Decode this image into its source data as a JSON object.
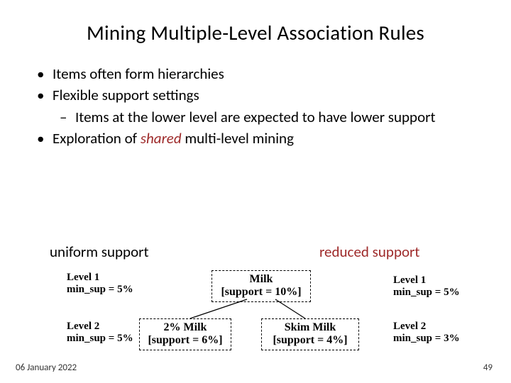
{
  "title": "Mining Multiple-Level Association Rules",
  "bullets": {
    "b1": "Items often form hierarchies",
    "b2": "Flexible support settings",
    "b2_sub": "Items at the lower level are expected to have lower support",
    "b3_pre": "Exploration of ",
    "b3_shared": "shared",
    "b3_post": " multi-level mining"
  },
  "labels": {
    "uniform": "uniform support",
    "reduced": "reduced support"
  },
  "levels": {
    "left1_a": "Level 1",
    "left1_b": "min_sup = 5%",
    "left2_a": "Level 2",
    "left2_b": "min_sup = 5%",
    "right1_a": "Level 1",
    "right1_b": "min_sup = 5%",
    "right2_a": "Level 2",
    "right2_b": "min_sup = 3%"
  },
  "boxes": {
    "milk_a": "Milk",
    "milk_b": "[support = 10%]",
    "two_a": "2% Milk",
    "two_b": "[support = 6%]",
    "skim_a": "Skim Milk",
    "skim_b": "[support = 4%]"
  },
  "footer": {
    "date": "06 January 2022",
    "page": "49"
  },
  "chart_data": {
    "type": "table",
    "title": "Multi-level support hierarchy",
    "hierarchy": {
      "node": "Milk",
      "support_pct": 10,
      "children": [
        {
          "node": "2% Milk",
          "support_pct": 6
        },
        {
          "node": "Skim Milk",
          "support_pct": 4
        }
      ]
    },
    "uniform_support": {
      "level1_min_sup_pct": 5,
      "level2_min_sup_pct": 5
    },
    "reduced_support": {
      "level1_min_sup_pct": 5,
      "level2_min_sup_pct": 3
    }
  }
}
